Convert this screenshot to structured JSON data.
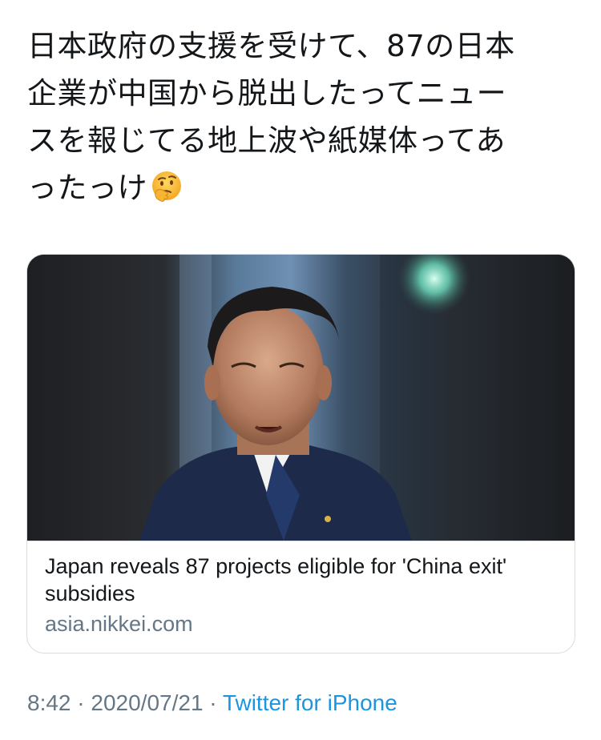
{
  "tweet": {
    "lines": [
      "日本政府の支援を受けて、87の日本",
      "企業が中国から脱出したってニュー",
      "スを報じてる地上波や紙媒体ってあ",
      "ったっけ"
    ],
    "emoji": "thinking-face-icon"
  },
  "card": {
    "title": "Japan reveals 87 projects eligible for 'China exit' subsidies",
    "domain": "asia.nikkei.com"
  },
  "meta": {
    "time": "8:42",
    "separator": " · ",
    "date": "2020/07/21",
    "source": "Twitter for iPhone"
  },
  "colors": {
    "text": "#14171a",
    "secondary": "#657786",
    "link": "#1b95e0",
    "border": "#d6dde3"
  }
}
